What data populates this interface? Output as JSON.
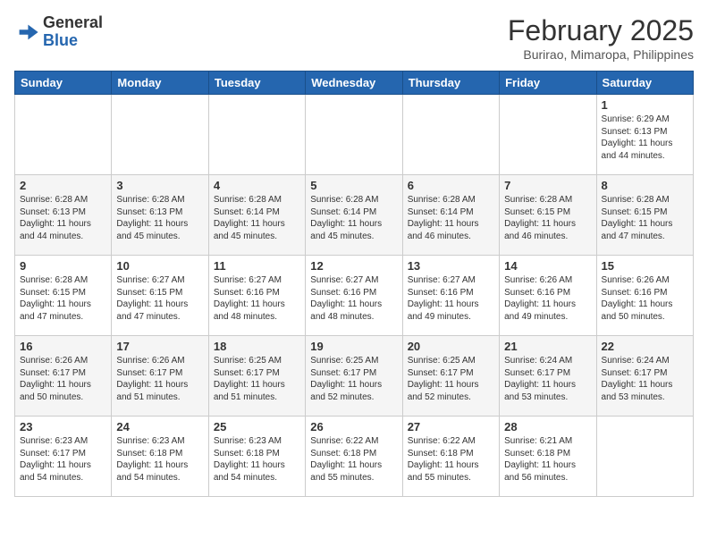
{
  "header": {
    "logo_general": "General",
    "logo_blue": "Blue",
    "month_year": "February 2025",
    "location": "Burirao, Mimaropa, Philippines"
  },
  "weekdays": [
    "Sunday",
    "Monday",
    "Tuesday",
    "Wednesday",
    "Thursday",
    "Friday",
    "Saturday"
  ],
  "weeks": [
    [
      {
        "day": "",
        "info": ""
      },
      {
        "day": "",
        "info": ""
      },
      {
        "day": "",
        "info": ""
      },
      {
        "day": "",
        "info": ""
      },
      {
        "day": "",
        "info": ""
      },
      {
        "day": "",
        "info": ""
      },
      {
        "day": "1",
        "info": "Sunrise: 6:29 AM\nSunset: 6:13 PM\nDaylight: 11 hours\nand 44 minutes."
      }
    ],
    [
      {
        "day": "2",
        "info": "Sunrise: 6:28 AM\nSunset: 6:13 PM\nDaylight: 11 hours\nand 44 minutes."
      },
      {
        "day": "3",
        "info": "Sunrise: 6:28 AM\nSunset: 6:13 PM\nDaylight: 11 hours\nand 45 minutes."
      },
      {
        "day": "4",
        "info": "Sunrise: 6:28 AM\nSunset: 6:14 PM\nDaylight: 11 hours\nand 45 minutes."
      },
      {
        "day": "5",
        "info": "Sunrise: 6:28 AM\nSunset: 6:14 PM\nDaylight: 11 hours\nand 45 minutes."
      },
      {
        "day": "6",
        "info": "Sunrise: 6:28 AM\nSunset: 6:14 PM\nDaylight: 11 hours\nand 46 minutes."
      },
      {
        "day": "7",
        "info": "Sunrise: 6:28 AM\nSunset: 6:15 PM\nDaylight: 11 hours\nand 46 minutes."
      },
      {
        "day": "8",
        "info": "Sunrise: 6:28 AM\nSunset: 6:15 PM\nDaylight: 11 hours\nand 47 minutes."
      }
    ],
    [
      {
        "day": "9",
        "info": "Sunrise: 6:28 AM\nSunset: 6:15 PM\nDaylight: 11 hours\nand 47 minutes."
      },
      {
        "day": "10",
        "info": "Sunrise: 6:27 AM\nSunset: 6:15 PM\nDaylight: 11 hours\nand 47 minutes."
      },
      {
        "day": "11",
        "info": "Sunrise: 6:27 AM\nSunset: 6:16 PM\nDaylight: 11 hours\nand 48 minutes."
      },
      {
        "day": "12",
        "info": "Sunrise: 6:27 AM\nSunset: 6:16 PM\nDaylight: 11 hours\nand 48 minutes."
      },
      {
        "day": "13",
        "info": "Sunrise: 6:27 AM\nSunset: 6:16 PM\nDaylight: 11 hours\nand 49 minutes."
      },
      {
        "day": "14",
        "info": "Sunrise: 6:26 AM\nSunset: 6:16 PM\nDaylight: 11 hours\nand 49 minutes."
      },
      {
        "day": "15",
        "info": "Sunrise: 6:26 AM\nSunset: 6:16 PM\nDaylight: 11 hours\nand 50 minutes."
      }
    ],
    [
      {
        "day": "16",
        "info": "Sunrise: 6:26 AM\nSunset: 6:17 PM\nDaylight: 11 hours\nand 50 minutes."
      },
      {
        "day": "17",
        "info": "Sunrise: 6:26 AM\nSunset: 6:17 PM\nDaylight: 11 hours\nand 51 minutes."
      },
      {
        "day": "18",
        "info": "Sunrise: 6:25 AM\nSunset: 6:17 PM\nDaylight: 11 hours\nand 51 minutes."
      },
      {
        "day": "19",
        "info": "Sunrise: 6:25 AM\nSunset: 6:17 PM\nDaylight: 11 hours\nand 52 minutes."
      },
      {
        "day": "20",
        "info": "Sunrise: 6:25 AM\nSunset: 6:17 PM\nDaylight: 11 hours\nand 52 minutes."
      },
      {
        "day": "21",
        "info": "Sunrise: 6:24 AM\nSunset: 6:17 PM\nDaylight: 11 hours\nand 53 minutes."
      },
      {
        "day": "22",
        "info": "Sunrise: 6:24 AM\nSunset: 6:17 PM\nDaylight: 11 hours\nand 53 minutes."
      }
    ],
    [
      {
        "day": "23",
        "info": "Sunrise: 6:23 AM\nSunset: 6:17 PM\nDaylight: 11 hours\nand 54 minutes."
      },
      {
        "day": "24",
        "info": "Sunrise: 6:23 AM\nSunset: 6:18 PM\nDaylight: 11 hours\nand 54 minutes."
      },
      {
        "day": "25",
        "info": "Sunrise: 6:23 AM\nSunset: 6:18 PM\nDaylight: 11 hours\nand 54 minutes."
      },
      {
        "day": "26",
        "info": "Sunrise: 6:22 AM\nSunset: 6:18 PM\nDaylight: 11 hours\nand 55 minutes."
      },
      {
        "day": "27",
        "info": "Sunrise: 6:22 AM\nSunset: 6:18 PM\nDaylight: 11 hours\nand 55 minutes."
      },
      {
        "day": "28",
        "info": "Sunrise: 6:21 AM\nSunset: 6:18 PM\nDaylight: 11 hours\nand 56 minutes."
      },
      {
        "day": "",
        "info": ""
      }
    ]
  ]
}
